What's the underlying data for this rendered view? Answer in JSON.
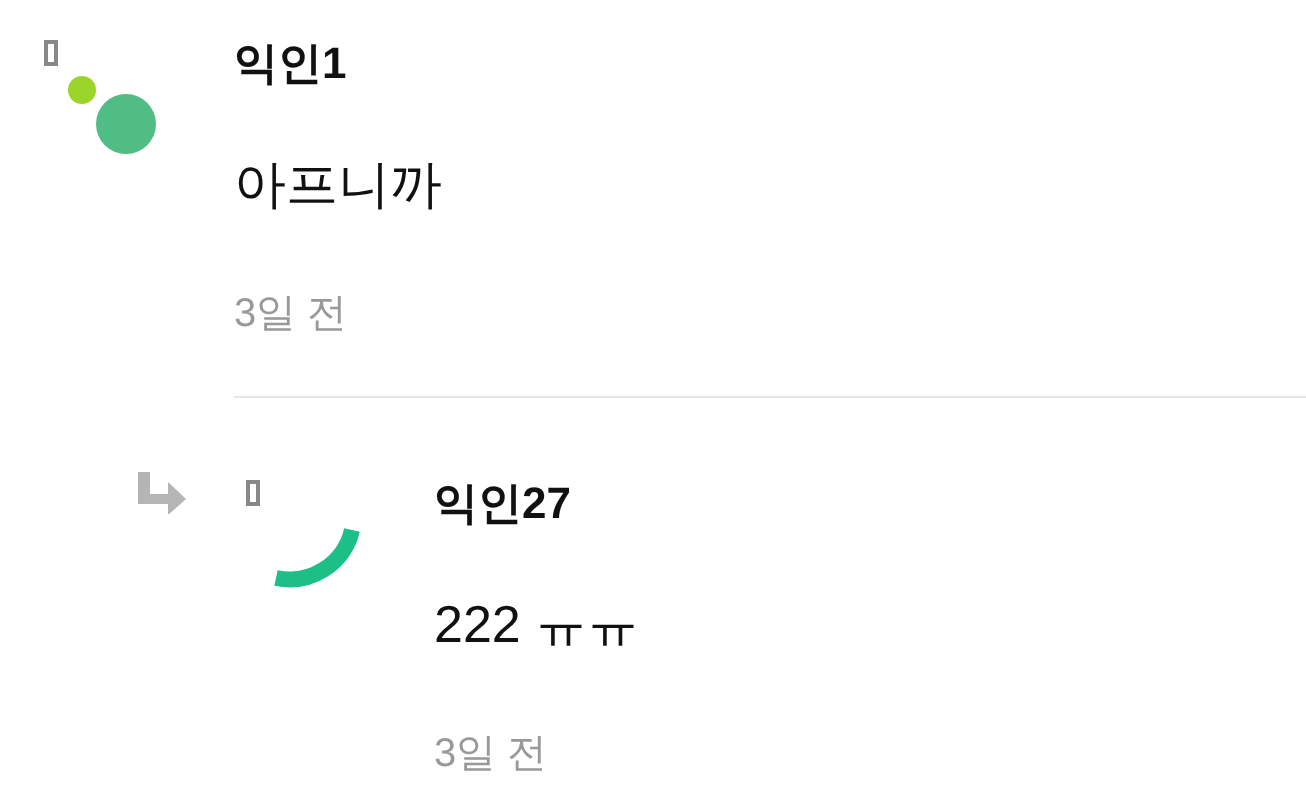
{
  "comments": [
    {
      "author": "익인1",
      "body": "아프니까",
      "time": "3일 전",
      "reply": false
    },
    {
      "author": "익인27",
      "body": "222 ㅠㅠ",
      "time": "3일 전",
      "reply": true
    }
  ]
}
